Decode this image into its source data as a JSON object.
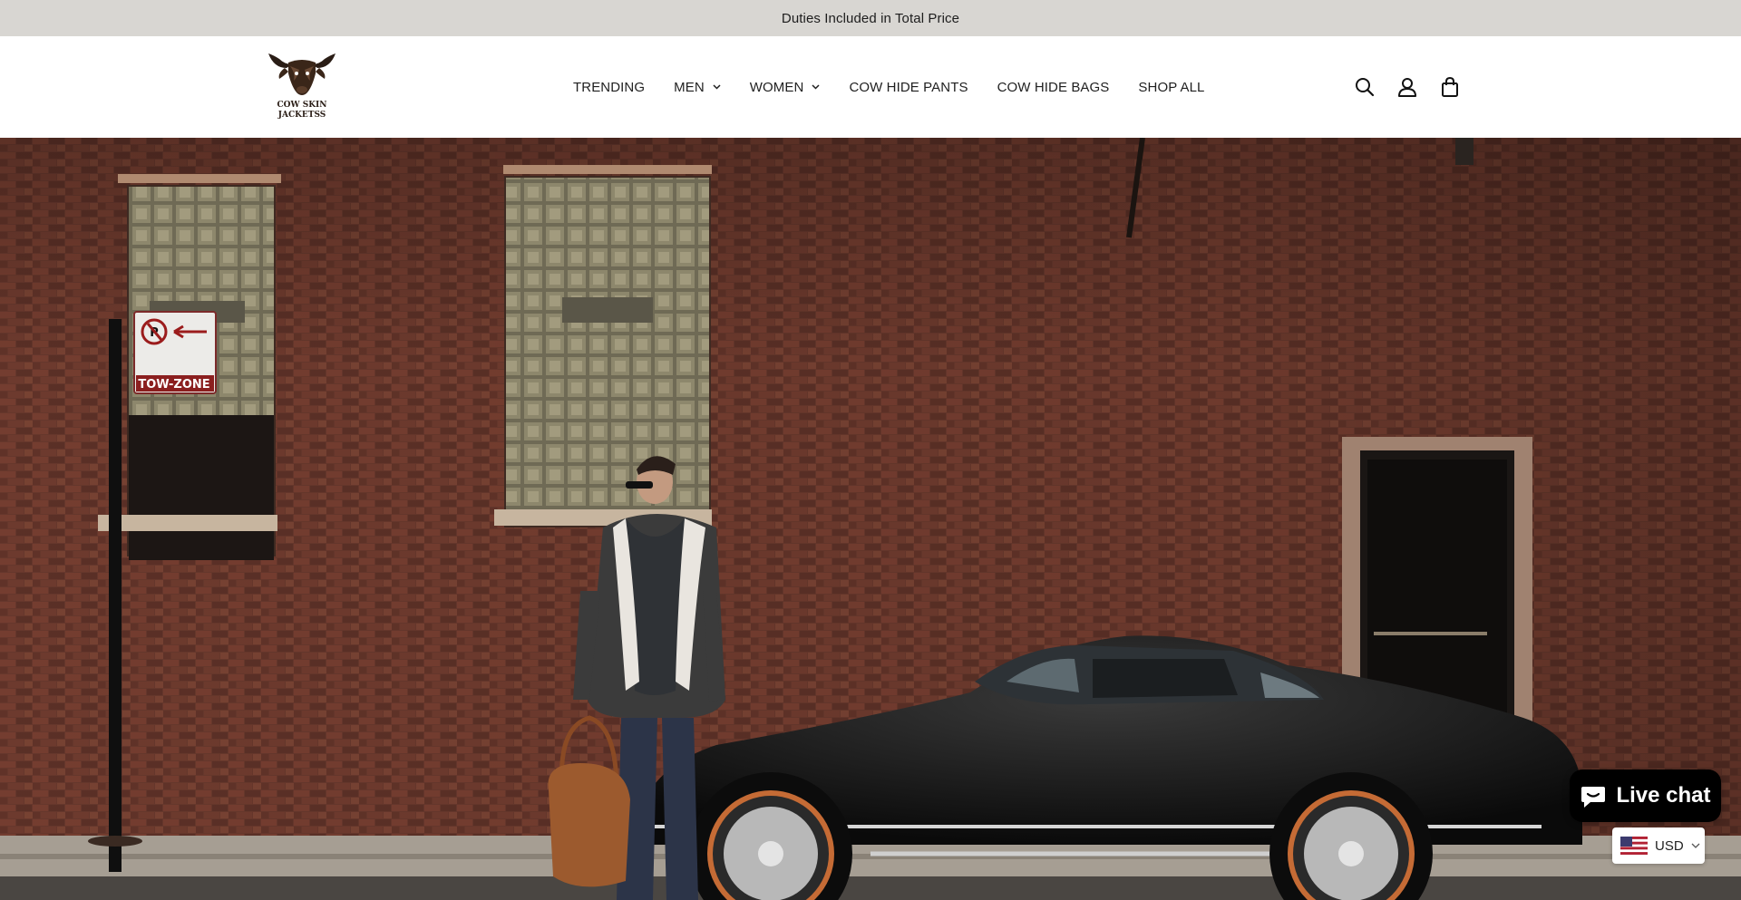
{
  "announcement": {
    "text": "Duties Included in Total Price"
  },
  "logo": {
    "line1": "COW SKIN",
    "line2": "JACKETSS",
    "icon": "bull-head-logo"
  },
  "nav": {
    "items": [
      {
        "label": "TRENDING",
        "dropdown": false
      },
      {
        "label": "MEN",
        "dropdown": true
      },
      {
        "label": "WOMEN",
        "dropdown": true
      },
      {
        "label": "COW HIDE PANTS",
        "dropdown": false
      },
      {
        "label": "COW HIDE BAGS",
        "dropdown": false
      },
      {
        "label": "SHOP ALL",
        "dropdown": false
      }
    ]
  },
  "header_icons": [
    "search-icon",
    "account-icon",
    "cart-icon"
  ],
  "hero": {
    "sign_text": "TOW-ZONE",
    "image": "man in shearling jacket with leather bag beside black classic sports car in front of brick wall"
  },
  "livechat": {
    "label": "Live chat",
    "icon": "chat-bubble-icon"
  },
  "currency": {
    "code": "USD",
    "flag": "us-flag-icon"
  },
  "colors": {
    "announcement_bg": "#d8d6d2",
    "header_bg": "#ffffff",
    "chat_bg": "#000000",
    "brick": "#6e3a2c"
  }
}
